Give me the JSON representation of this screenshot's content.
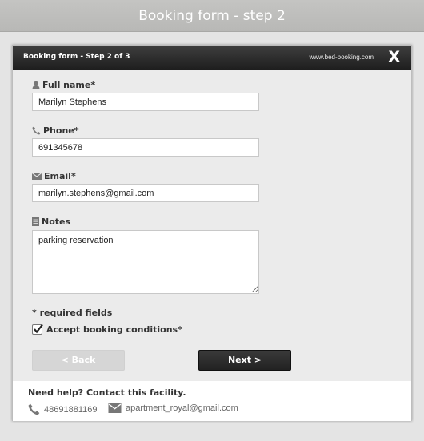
{
  "page": {
    "header_title": "Booking form - step 2"
  },
  "modal": {
    "title": "Booking form - Step 2 of 3",
    "site": "www.bed-booking.com",
    "close_label": "X"
  },
  "form": {
    "full_name": {
      "label": "Full name*",
      "value": "Marilyn Stephens",
      "icon": "person-icon"
    },
    "phone": {
      "label": "Phone*",
      "value": "691345678",
      "icon": "phone-icon"
    },
    "email": {
      "label": "Email*",
      "value": "marilyn.stephens@gmail.com",
      "icon": "envelope-icon"
    },
    "notes": {
      "label": "Notes",
      "value": "parking reservation",
      "icon": "notes-icon"
    },
    "required_note": "* required fields",
    "accept": {
      "label": "Accept booking conditions*",
      "checked": true
    }
  },
  "buttons": {
    "back": "< Back",
    "next": "Next >"
  },
  "help": {
    "title": "Need help? Contact this facility.",
    "phone": "48691881169",
    "email": "apartment_royal@gmail.com"
  },
  "colors": {
    "titlebar": "#2a2a2a",
    "page_header": "#bdbdbb",
    "next_button": "#2e2e2e",
    "back_button": "#d6d6d6"
  }
}
